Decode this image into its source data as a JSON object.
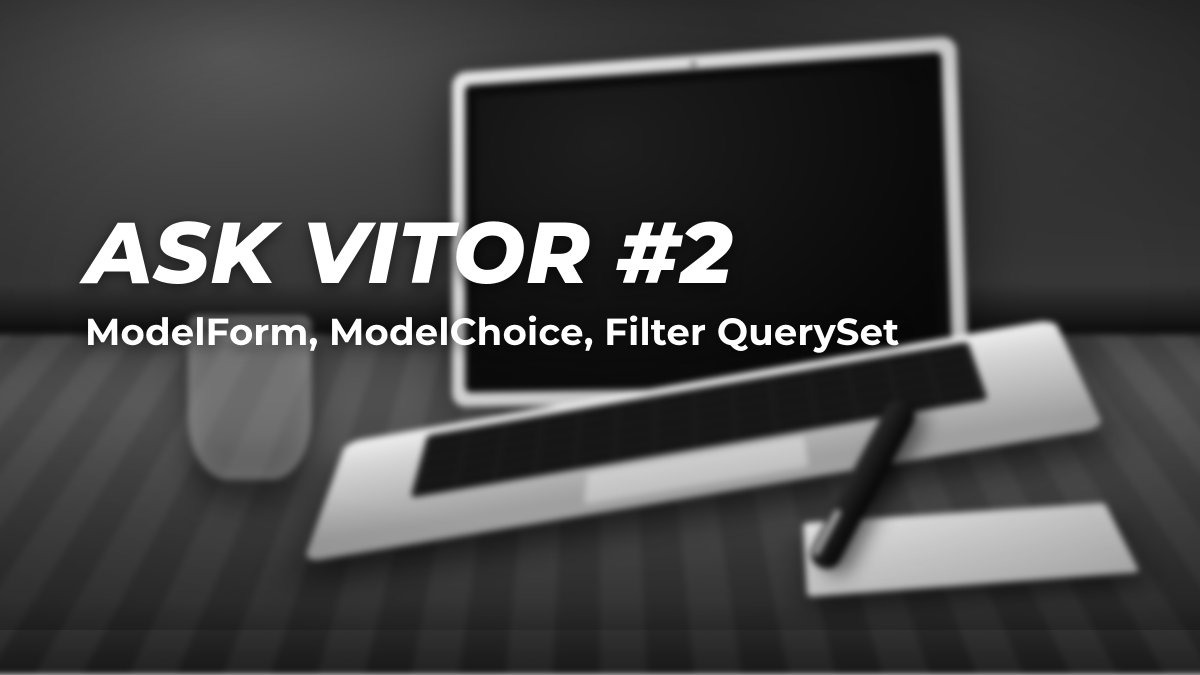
{
  "hero": {
    "title": "ASK VITOR #2",
    "subtitle": "ModelForm, ModelChoice, Filter QuerySet"
  }
}
